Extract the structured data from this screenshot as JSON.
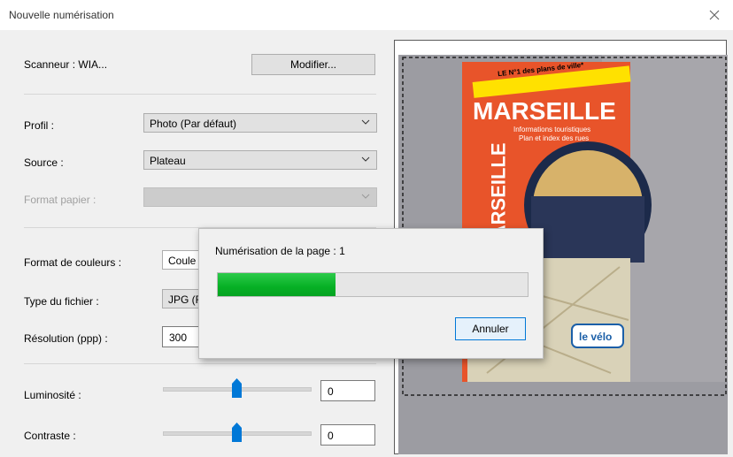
{
  "window": {
    "title": "Nouvelle numérisation",
    "close_icon": "close-icon"
  },
  "scanner": {
    "label": "Scanneur : WIA...",
    "modify_button": "Modifier..."
  },
  "fields": {
    "profile": {
      "label": "Profil :",
      "value": "Photo (Par défaut)"
    },
    "source": {
      "label": "Source :",
      "value": "Plateau"
    },
    "paper_format": {
      "label": "Format papier :",
      "value": ""
    },
    "color_format": {
      "label": "Format de couleurs :",
      "value": "Coule"
    },
    "file_type": {
      "label": "Type du fichier :",
      "value": "JPG (F"
    },
    "resolution": {
      "label": "Résolution (ppp) :",
      "value": "300"
    },
    "brightness": {
      "label": "Luminosité :",
      "value": "0",
      "level": 0
    },
    "contrast": {
      "label": "Contraste :",
      "value": "0",
      "level": 0
    }
  },
  "progress_dialog": {
    "message": "Numérisation de la page : 1",
    "progress_fraction": 0.38,
    "cancel_button": "Annuler"
  },
  "preview": {
    "cover_banner": "LE N°1 des plans de ville*",
    "cover_title": "MARSEILLE",
    "cover_subtitle_1": "Informations touristiques",
    "cover_subtitle_2": "Plan et index des rues",
    "cover_spine": "MARSEILLE",
    "cover_badge": "le vélo",
    "colors": {
      "cover_orange": "#e8542a",
      "cover_yellow": "#ffe100",
      "progress_green": "#06b025",
      "accent": "#0078d7"
    }
  }
}
